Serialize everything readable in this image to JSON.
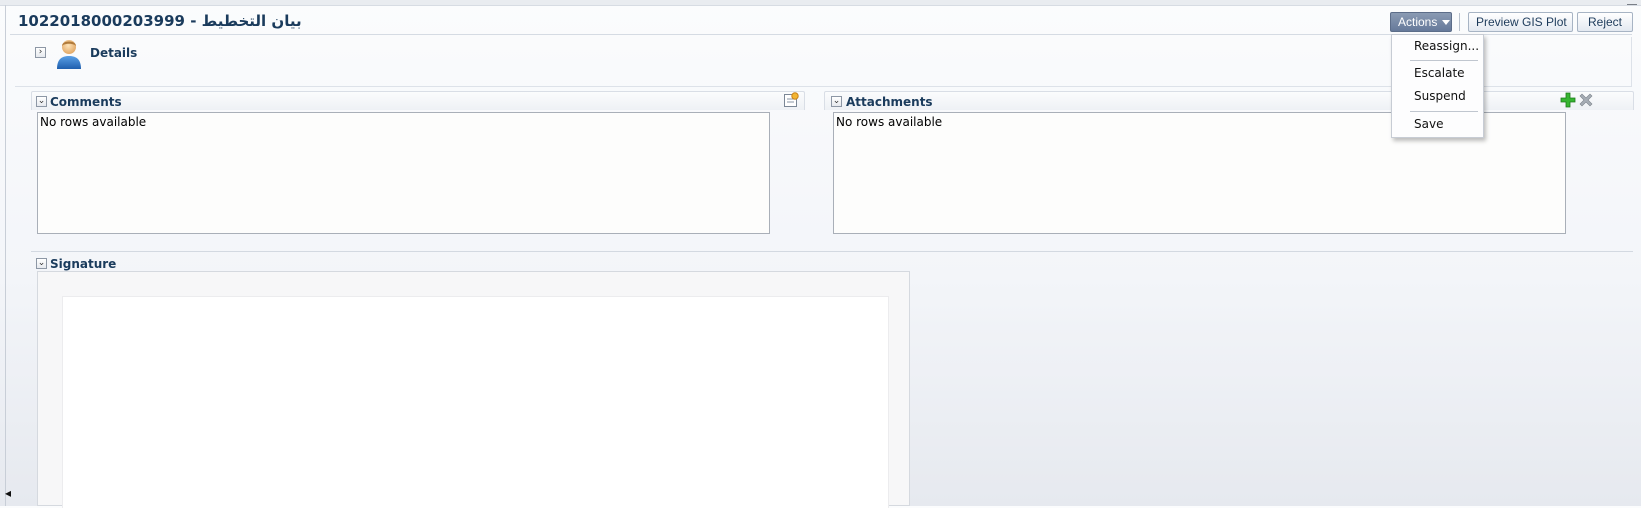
{
  "header": {
    "title": "1022018000203999 - بيان التخطيط"
  },
  "toolbar": {
    "actions_label": "Actions",
    "preview_gis_label": "Preview GIS Plot",
    "reject_label": "Reject"
  },
  "actions_menu": {
    "items": [
      "Reassign...",
      "Escalate",
      "Suspend",
      "Save"
    ]
  },
  "details": {
    "label": "Details",
    "expander": "›"
  },
  "comments": {
    "label": "Comments",
    "empty_text": "No rows available"
  },
  "attachments": {
    "label": "Attachments",
    "empty_text": "No rows available"
  },
  "signature": {
    "label": "Signature"
  },
  "icons": {
    "user": "user-icon",
    "add_comment": "add-comment-icon",
    "add": "add-icon",
    "delete": "delete-icon",
    "collapse": "collapse-icon"
  },
  "colors": {
    "title": "#1a3b5c",
    "actions_button": "#75879f",
    "add_icon": "#2fa52c",
    "delete_icon": "#9aa0a8"
  }
}
